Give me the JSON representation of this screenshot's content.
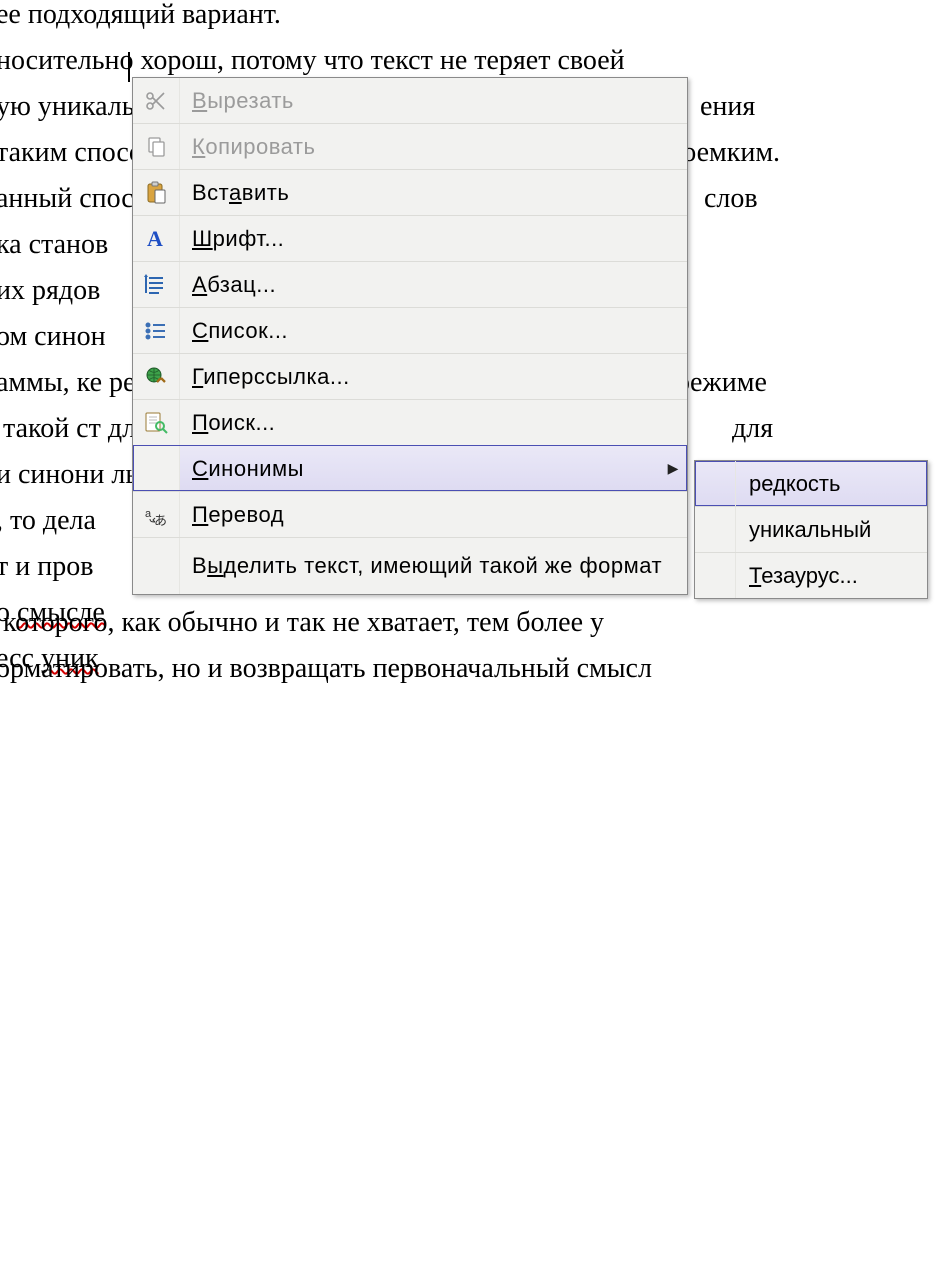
{
  "document": {
    "lines": [
      "ее подходящий вариант.",
      "носительно хорош, потому что текст не теряет своей",
      "ую уникальность. Но после очередного обновления",
      "таким способом стало трудоемким.",
      "анный способ слов",
      "ка станов",
      "их рядов",
      "ом синон",
      "аммы, ке режиме",
      " такой ст для",
      "и синони льный",
      ", то дела",
      "т и пров",
      "о смысле",
      "есс уник",
      " которого, как обычно и так не хватает, тем более у",
      "орматировать, но и возвращать первоначальный смысл"
    ],
    "squiggles": {
      "line13_word": "смысле",
      "line14_word": "уник"
    }
  },
  "context_menu": {
    "items": [
      {
        "label": "Вырезать",
        "hotkey_index": 0,
        "icon": "cut",
        "disabled": true
      },
      {
        "label": "Копировать",
        "hotkey_index": 0,
        "icon": "copy",
        "disabled": true
      },
      {
        "label": "Вставить",
        "hotkey_index": 3,
        "icon": "paste",
        "disabled": false
      },
      {
        "label": "Шрифт...",
        "hotkey_index": 0,
        "icon": "font",
        "disabled": false
      },
      {
        "label": "Абзац...",
        "hotkey_index": 0,
        "icon": "paragraph",
        "disabled": false
      },
      {
        "label": "Список...",
        "hotkey_index": 0,
        "icon": "list",
        "disabled": false
      },
      {
        "label": "Гиперссылка...",
        "hotkey_index": 0,
        "icon": "hyperlink",
        "disabled": false
      },
      {
        "label": "Поиск...",
        "hotkey_index": 0,
        "icon": "search",
        "disabled": false
      },
      {
        "label": "Синонимы",
        "hotkey_index": 0,
        "icon": "",
        "disabled": false,
        "submenu": true,
        "highlight": true
      },
      {
        "label": "Перевод",
        "hotkey_index": 0,
        "icon": "translate",
        "disabled": false
      },
      {
        "label": "Выделить текст, имеющий такой же формат",
        "hotkey_index": 0,
        "icon": "",
        "disabled": false,
        "tall": true
      }
    ]
  },
  "synonyms_submenu": {
    "items": [
      {
        "label": "редкость",
        "highlight": true
      },
      {
        "label": "уникальный",
        "highlight": false
      },
      {
        "label": "Тезаурус...",
        "hotkey_index": 0,
        "highlight": false
      }
    ]
  },
  "icons": {
    "cut": "scissors-icon",
    "copy": "copy-icon",
    "paste": "paste-icon",
    "font": "font-a-icon",
    "paragraph": "paragraph-icon",
    "list": "list-icon",
    "hyperlink": "hyperlink-icon",
    "search": "search-icon",
    "translate": "translate-icon"
  }
}
